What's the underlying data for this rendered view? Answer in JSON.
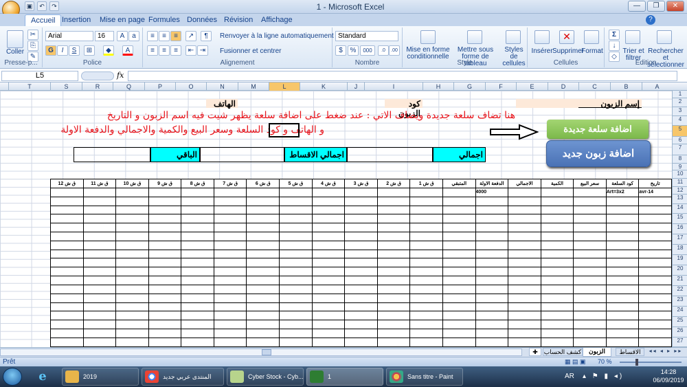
{
  "window": {
    "title": "1 - Microsoft Excel"
  },
  "ribbon": {
    "tabs": [
      "Accueil",
      "Insertion",
      "Mise en page",
      "Formules",
      "Données",
      "Révision",
      "Affichage"
    ],
    "clipboard": {
      "paste": "Coller",
      "label": "Presse-p..."
    },
    "font": {
      "name": "Arial",
      "size": "16",
      "label": "Police",
      "bold": "G",
      "italic": "I",
      "underline": "S"
    },
    "alignment": {
      "wrap": "Renvoyer à la ligne automatiquement",
      "merge": "Fusionner et centrer",
      "label": "Alignement"
    },
    "number": {
      "format": "Standard",
      "percent": "%",
      "thousands": "000",
      "label": "Nombre"
    },
    "styles": {
      "conditional": "Mise en forme conditionnelle",
      "as_table": "Mettre sous forme de tableau",
      "cell_styles": "Styles de cellules",
      "label": "Style"
    },
    "cells": {
      "insert": "Insérer",
      "delete": "Supprimer",
      "format": "Format",
      "label": "Cellules"
    },
    "editing": {
      "sort": "Trier et filtrer",
      "find": "Rechercher et sélectionner",
      "label": "Édition",
      "sigma": "Σ"
    }
  },
  "formula_bar": {
    "cell": "L5",
    "fx": "fx",
    "content": ""
  },
  "columns": [
    "A",
    "B",
    "C",
    "D",
    "E",
    "F",
    "G",
    "H",
    "I",
    "J",
    "K",
    "L",
    "M",
    "N",
    "O",
    "P",
    "Q",
    "R",
    "S",
    "T"
  ],
  "rows": [
    "1",
    "2",
    "3",
    "4",
    "5",
    "6",
    "7",
    "8",
    "9",
    "10",
    "11",
    "12",
    "13",
    "14",
    "15",
    "16",
    "17",
    "18",
    "19",
    "20",
    "21",
    "22",
    "23",
    "24",
    "25",
    "26",
    "27"
  ],
  "selected": {
    "column": "L",
    "row": "5"
  },
  "sheet": {
    "customer_name": "إسم الزبون",
    "customer_code": "كود الزبون",
    "phone": "الهاتف",
    "note_line1": "هنا تضاف سلعة جديدة  ويضاف الاتي : عند ضغط على اضافة سلعة يظهر شيت فيه اسم الزبون و التاريخ",
    "note_line2": "و الهاتف و كود السلعة وسعر البيع والكمية والاجمالي والدفعة الاولة",
    "add_item_button": "اضافة سلعة جديدة",
    "add_customer_button": "اضافة زبون جديد",
    "total": "اجمالي",
    "installments_total": "اجمالي الاقساط",
    "remaining": "الباقي",
    "table_headers": [
      "تاريخ",
      "كود السلعة",
      "سعر البيع",
      "الكمية",
      "الاجمالي",
      "الدفعة الاولة",
      "المتبقي",
      "ق ش 1",
      "ق ش 2",
      "ق ش 3",
      "ق ش 4",
      "ق ش 5",
      "ق ش 6",
      "ق ش 7",
      "ق ش 8",
      "ق ش 9",
      "ق ش 10",
      "ق ش 11",
      "ق ش 12"
    ],
    "first_row": [
      "14-avr",
      "Art=3x2",
      "",
      "",
      "",
      "4000",
      "",
      "",
      "",
      "",
      "",
      "",
      "",
      "",
      "",
      "",
      "",
      "",
      ""
    ]
  },
  "sheet_tabs": [
    "الزبون",
    "كشف الحساب",
    "الاقساط"
  ],
  "status": {
    "ready": "Prêt",
    "zoom": "70 %"
  },
  "taskbar": {
    "items": [
      "2019",
      "المنتدى عربي جديد",
      "Cyber Stock - Cyb...",
      "1",
      "Sans titre - Paint"
    ],
    "lang": "AR",
    "time": "14:28",
    "date": "06/09/2019"
  },
  "colors": {
    "accent": "#00ffff",
    "button_green": "#8cc459",
    "button_blue": "#5b82c3",
    "selection": "#f7c66a"
  }
}
